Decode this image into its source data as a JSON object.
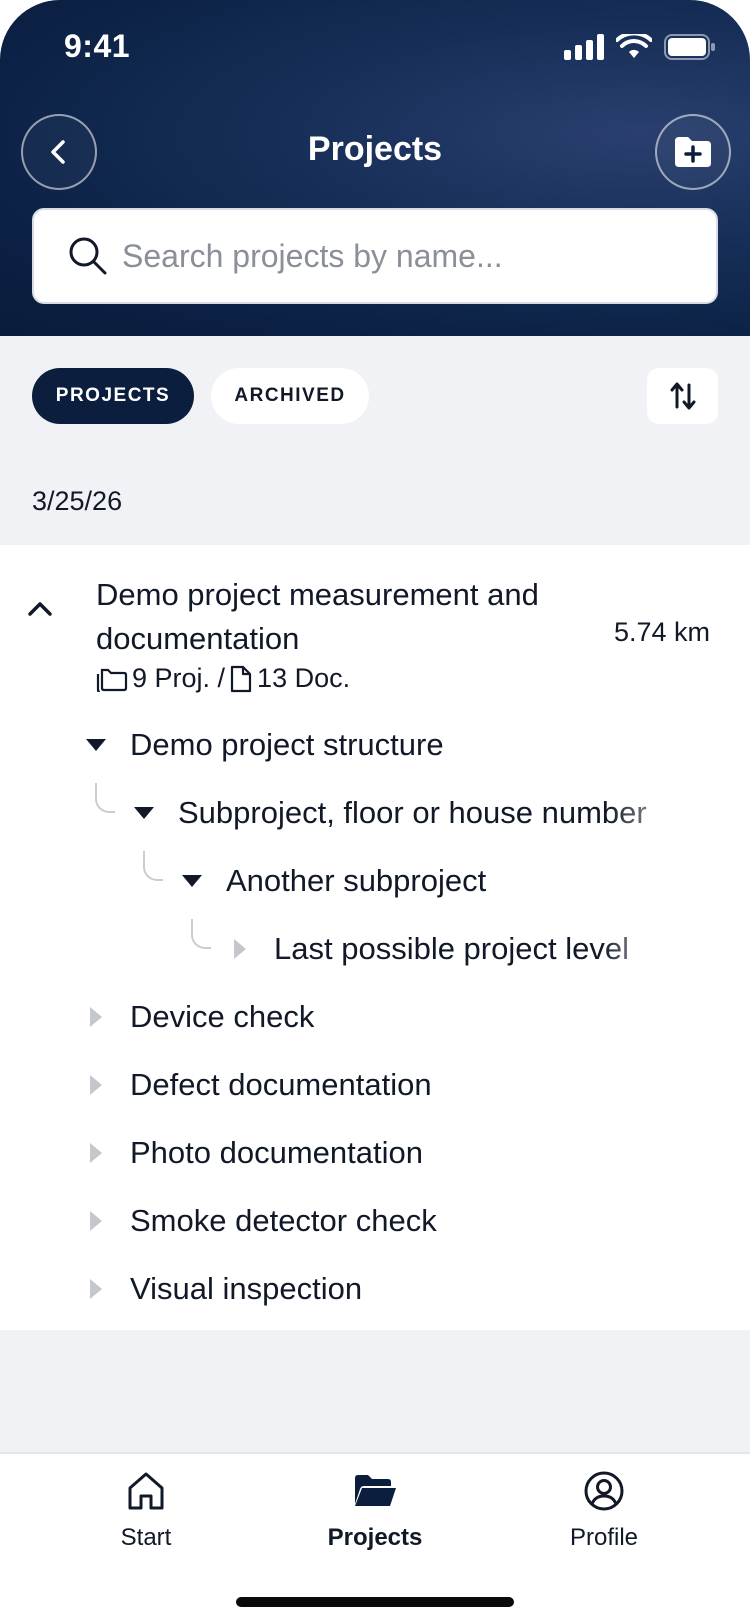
{
  "status": {
    "time": "9:41"
  },
  "header": {
    "title": "Projects"
  },
  "search": {
    "placeholder": "Search projects by name..."
  },
  "filters": {
    "active": "PROJECTS",
    "inactive": "ARCHIVED"
  },
  "date_group": "3/25/26",
  "project": {
    "title": "Demo project measurement and documentation",
    "distance": "5.74 km",
    "projects_count": "9 Proj. /",
    "documents_count": "13 Doc."
  },
  "tree": [
    {
      "label": "Demo project structure",
      "expanded": true,
      "level": 0
    },
    {
      "label": "Subproject, floor or house number",
      "expanded": true,
      "level": 1
    },
    {
      "label": "Another subproject",
      "expanded": true,
      "level": 2
    },
    {
      "label": "Last possible project level",
      "expanded": false,
      "level": 3
    },
    {
      "label": "Device check",
      "expanded": false,
      "level": 0
    },
    {
      "label": "Defect documentation",
      "expanded": false,
      "level": 0
    },
    {
      "label": "Photo documentation",
      "expanded": false,
      "level": 0
    },
    {
      "label": "Smoke detector check",
      "expanded": false,
      "level": 0
    },
    {
      "label": "Visual inspection",
      "expanded": false,
      "level": 0
    }
  ],
  "nav": [
    {
      "label": "Start",
      "icon": "home-icon",
      "active": false
    },
    {
      "label": "Projects",
      "icon": "folder-open-icon",
      "active": true
    },
    {
      "label": "Profile",
      "icon": "user-circle-icon",
      "active": false
    }
  ],
  "colors": {
    "header_dark": "#0b2145",
    "chip_active": "#0c1e3d",
    "background": "#f1f2f5"
  }
}
